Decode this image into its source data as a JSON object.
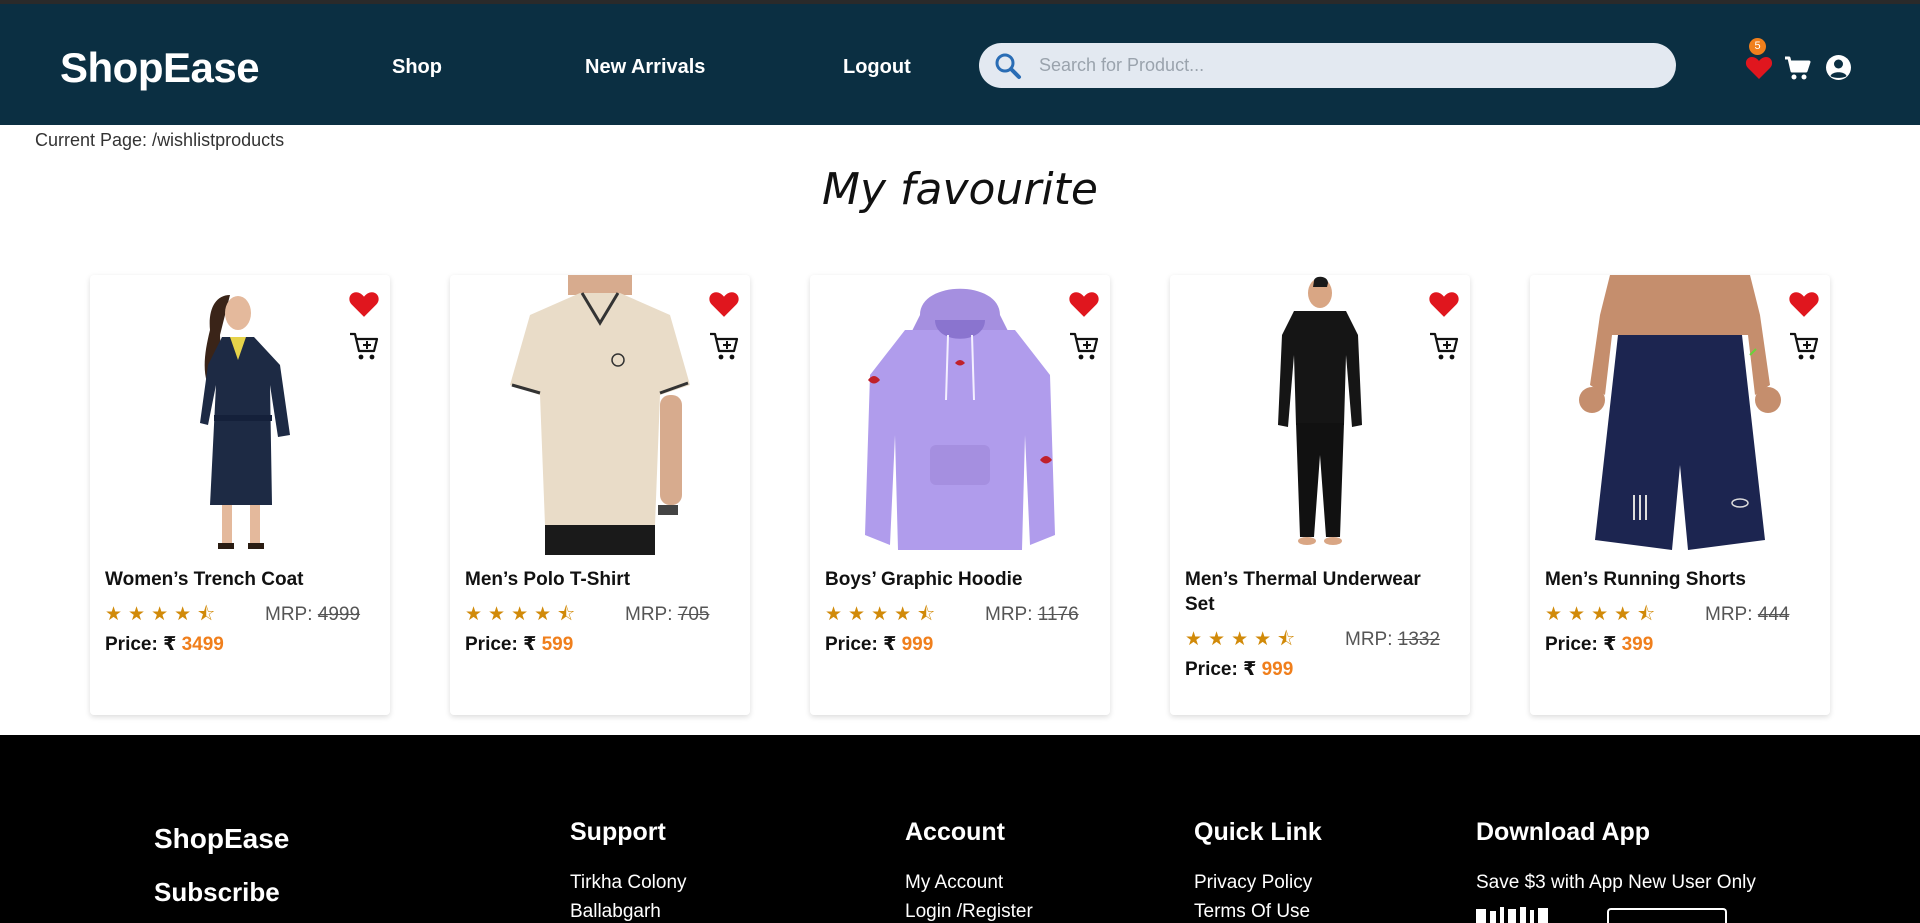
{
  "app": {
    "logo": "ShopEase"
  },
  "nav": {
    "links": [
      "Shop",
      "New Arrivals",
      "Logout"
    ],
    "search_placeholder": "Search for Product...",
    "wishlist_count": "5",
    "icons": [
      "search-icon",
      "heart-icon",
      "cart-icon",
      "user-icon"
    ]
  },
  "current_page": "Current Page: /wishlistproducts",
  "page_title": "My favourite",
  "product_labels": {
    "mrp": "MRP:",
    "price": "Price: ₹ "
  },
  "products": [
    {
      "title": "Women’s Trench Coat",
      "rating": 4.5,
      "stars": "★★★★⯪",
      "mrp": "4999",
      "price": "3499"
    },
    {
      "title": "Men’s Polo T-Shirt",
      "rating": 4.5,
      "stars": "★★★★⯪",
      "mrp": "705",
      "price": "599"
    },
    {
      "title": "Boys’ Graphic Hoodie",
      "rating": 4.5,
      "stars": "★★★★⯪",
      "mrp": "1176",
      "price": "999"
    },
    {
      "title": "Men’s Thermal Underwear Set",
      "rating": 4.5,
      "stars": "★★★★⯪",
      "mrp": "1332",
      "price": "999"
    },
    {
      "title": "Men’s Running Shorts",
      "rating": 4.5,
      "stars": "★★★★⯪",
      "mrp": "444",
      "price": "399"
    }
  ],
  "footer": {
    "brand": "ShopEase",
    "subscribe": "Subscribe",
    "support": {
      "heading": "Support",
      "lines": [
        "Tirkha Colony",
        "Ballabgarh"
      ]
    },
    "account": {
      "heading": "Account",
      "links": [
        "My Account",
        "Login /Register"
      ]
    },
    "quick_link": {
      "heading": "Quick Link",
      "links": [
        "Privacy Policy",
        "Terms Of Use"
      ]
    },
    "download": {
      "heading": "Download App",
      "text": "Save $3 with App New User Only"
    }
  },
  "colors": {
    "navbar": "#0b2f42",
    "accent_orange": "#f07f1c",
    "heart_red": "#e0161e",
    "star_gold": "#d18a09",
    "footer": "#000000"
  }
}
